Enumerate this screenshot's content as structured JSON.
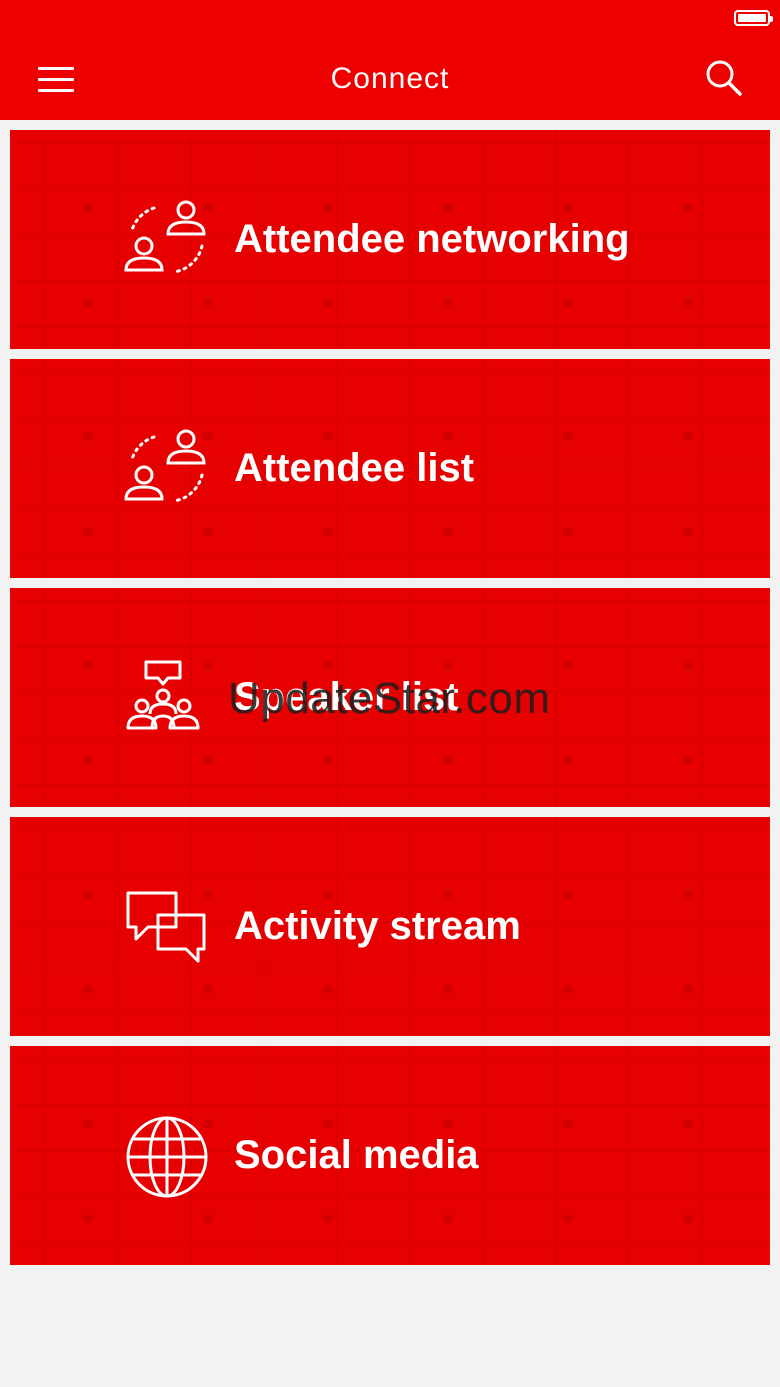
{
  "header": {
    "title": "Connect",
    "menu_icon": "hamburger-menu-icon",
    "search_icon": "search-icon"
  },
  "colors": {
    "brand_red": "#ee0000",
    "card_red": "#e60000",
    "background": "#f2f2f2",
    "text": "#ffffff"
  },
  "items": [
    {
      "label": "Attendee networking",
      "icon": "people-connect-icon"
    },
    {
      "label": "Attendee list",
      "icon": "people-connect-icon"
    },
    {
      "label": "Speaker list",
      "icon": "group-speaker-icon"
    },
    {
      "label": "Activity stream",
      "icon": "chat-bubbles-icon"
    },
    {
      "label": "Social media",
      "icon": "globe-icon"
    }
  ],
  "watermark": "UpdateStar.com"
}
